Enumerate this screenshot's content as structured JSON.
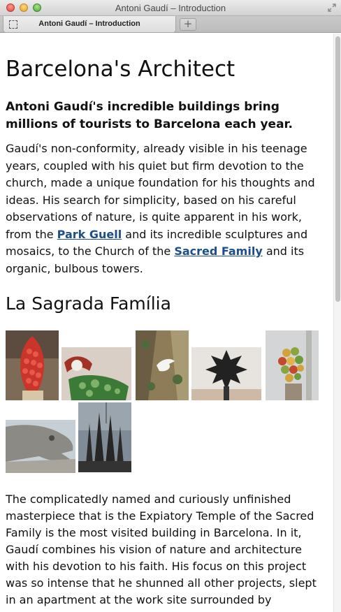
{
  "window": {
    "title": "Antoni Gaudí – Introduction",
    "tab_label": "Antoni Gaudí – Introduction",
    "new_tab_label": "+"
  },
  "article": {
    "heading": "Barcelona's Architect",
    "lead": "Antoni Gaudí's incredible buildings bring millions of tourists to Barcelona each year.",
    "paragraph1": {
      "before_link1": "Gaudí's non-conformity, already visible in his teenage years, coupled with his quiet but firm devotion to the church, made a unique foundation for his thoughts and ideas. His search for simplicity, based on his careful observations of nature, is quite apparent in his work, from the ",
      "link1": "Park Guell",
      "between_links": " and its incredible sculptures and mosaics, to the Church of the ",
      "link2": "Sacred Family",
      "after_link2": " and its organic, bulbous towers."
    },
    "section_heading": "La Sagrada Família",
    "gallery_photos": [
      "fruit-spire",
      "lizard-mosaic",
      "dove-relief",
      "dark-star",
      "fruit-pinnacle",
      "gargoyle",
      "towers"
    ],
    "paragraph2": "The complicatedly named and curiously unfinished masterpiece that is the Expiatory Temple of the Sacred Family is the most visited building in Barcelona. In it, Gaudí combines his vision of nature and architecture with his devotion to his faith. His focus on this project was so intense that he shunned all other projects, slept in an apartment at the work site surrounded by"
  },
  "colors": {
    "link": "#1b4f8a",
    "text": "#111111"
  }
}
